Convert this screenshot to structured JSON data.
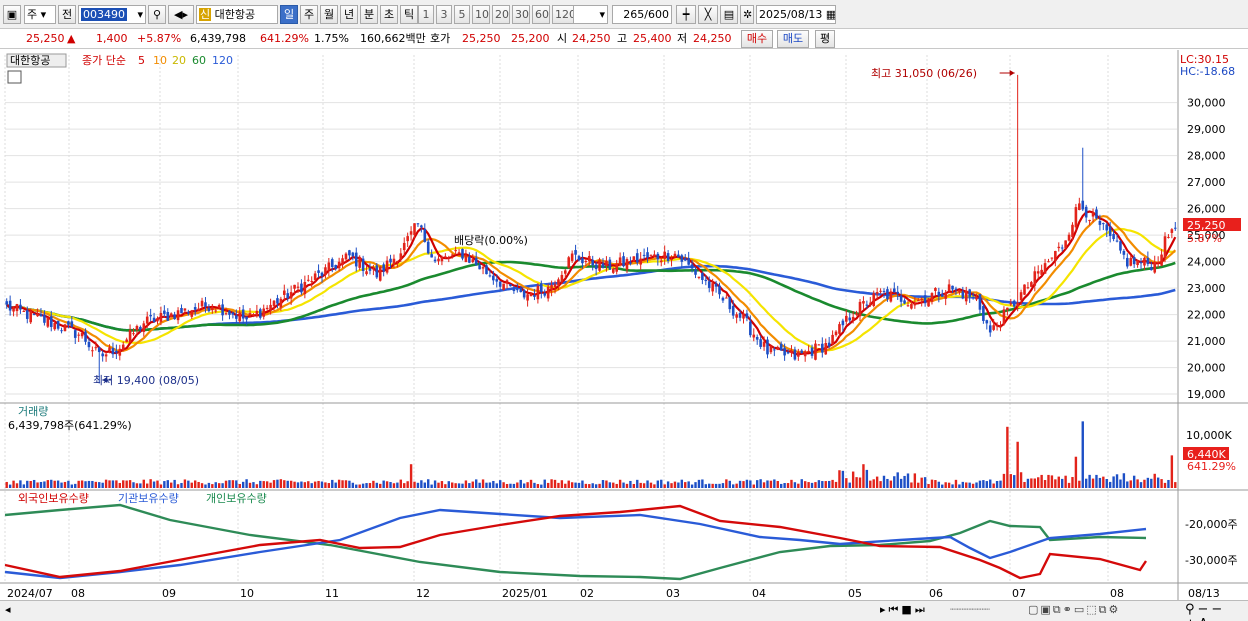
{
  "toolbar": {
    "market": "주",
    "prev": "전",
    "code": "003490",
    "credit_badge": "신",
    "stock_name": "대한항공",
    "periods": [
      "일",
      "주",
      "월",
      "년",
      "분",
      "초",
      "틱"
    ],
    "active_period": "일",
    "minute_options": [
      "1",
      "3",
      "5",
      "10",
      "20",
      "30",
      "60",
      "120"
    ],
    "bar_count": "265",
    "bar_total": "/600",
    "date": "2025/08/13"
  },
  "quote": {
    "price": "25,250",
    "change": "1,400",
    "change_pct": "+5.87%",
    "volume": "6,439,798",
    "volume_ratio": "641.29%",
    "turnover": "1.75%",
    "amount": "160,662백만",
    "bid_label": "호가",
    "bid": "25,250",
    "ask": "25,200",
    "open_label": "시",
    "open": "24,250",
    "high_label": "고",
    "high": "25,400",
    "low_label": "저",
    "low": "24,250",
    "buy": "매수",
    "sell": "매도",
    "avg": "평"
  },
  "price_panel": {
    "name_tag": "대한항공",
    "ma_title": "종가 단순",
    "ma_periods": [
      "5",
      "10",
      "20",
      "60",
      "120"
    ],
    "ma_colors": [
      "#d00000",
      "#f28c00",
      "#f5e400",
      "#1a8a2e",
      "#2a5bd7"
    ],
    "lc": "LC:30.15",
    "hc": "HC:-18.68",
    "high_note": "최고 31,050 (06/26)",
    "low_note": "최저 19,400 (08/05)",
    "ex_rights": "배당락(0.00%)",
    "last_price": "25,250",
    "last_pct": "5.87%"
  },
  "volume_panel": {
    "title": "거래량",
    "value": "6,439,798주(641.29%)",
    "axis_label": "10,000K",
    "last": "6,440K",
    "last_pct": "641.29%"
  },
  "holdings_panel": {
    "foreign": "외국인보유수량",
    "institution": "기관보유수량",
    "individual": "개인보유수량",
    "ticks": [
      "-20,000주",
      "-30,000주"
    ]
  },
  "x_labels": [
    "2024/07",
    "08",
    "09",
    "10",
    "11",
    "12",
    "2025/01",
    "02",
    "03",
    "04",
    "05",
    "06",
    "07",
    "08",
    "08/13"
  ],
  "chart_data": {
    "type": "candlestick",
    "ylim": [
      18700,
      31800
    ],
    "yticks": [
      19000,
      20000,
      21000,
      22000,
      23000,
      24000,
      25000,
      26000,
      27000,
      28000,
      29000,
      30000
    ],
    "yticklabels": [
      "19,000",
      "20,000",
      "21,000",
      "22,000",
      "23,000",
      "24,000",
      "25,000",
      "26,000",
      "27,000",
      "28,000",
      "29,000",
      "30,000"
    ],
    "close_anchors": [
      [
        0,
        22300
      ],
      [
        8,
        21900
      ],
      [
        15,
        21600
      ],
      [
        22,
        21200
      ],
      [
        27,
        20400
      ],
      [
        33,
        20800
      ],
      [
        40,
        21700
      ],
      [
        48,
        22000
      ],
      [
        60,
        22400
      ],
      [
        70,
        21800
      ],
      [
        80,
        22600
      ],
      [
        90,
        23400
      ],
      [
        100,
        24200
      ],
      [
        108,
        23500
      ],
      [
        115,
        24400
      ],
      [
        120,
        25400
      ],
      [
        125,
        24000
      ],
      [
        133,
        24300
      ],
      [
        140,
        23600
      ],
      [
        150,
        22700
      ],
      [
        158,
        23000
      ],
      [
        165,
        24200
      ],
      [
        175,
        23800
      ],
      [
        185,
        24100
      ],
      [
        195,
        24300
      ],
      [
        205,
        23100
      ],
      [
        215,
        21800
      ],
      [
        222,
        20600
      ],
      [
        230,
        20400
      ],
      [
        240,
        20900
      ],
      [
        247,
        22100
      ],
      [
        255,
        22800
      ],
      [
        265,
        22500
      ],
      [
        275,
        23000
      ],
      [
        283,
        22600
      ],
      [
        287,
        21300
      ],
      [
        295,
        22600
      ],
      [
        300,
        23400
      ],
      [
        308,
        24600
      ],
      [
        313,
        26200
      ],
      [
        320,
        25200
      ],
      [
        327,
        24000
      ],
      [
        335,
        23900
      ],
      [
        340,
        25250
      ]
    ],
    "high_label": {
      "index": 295,
      "value": 31050
    },
    "low_label": {
      "index": 27,
      "value": 19400
    },
    "volume_spikes": [
      [
        118,
        0.35
      ],
      [
        250,
        0.35
      ],
      [
        292,
        0.9
      ],
      [
        295,
        0.68
      ],
      [
        312,
        0.46
      ],
      [
        314,
        0.98
      ],
      [
        340,
        0.48
      ]
    ]
  }
}
